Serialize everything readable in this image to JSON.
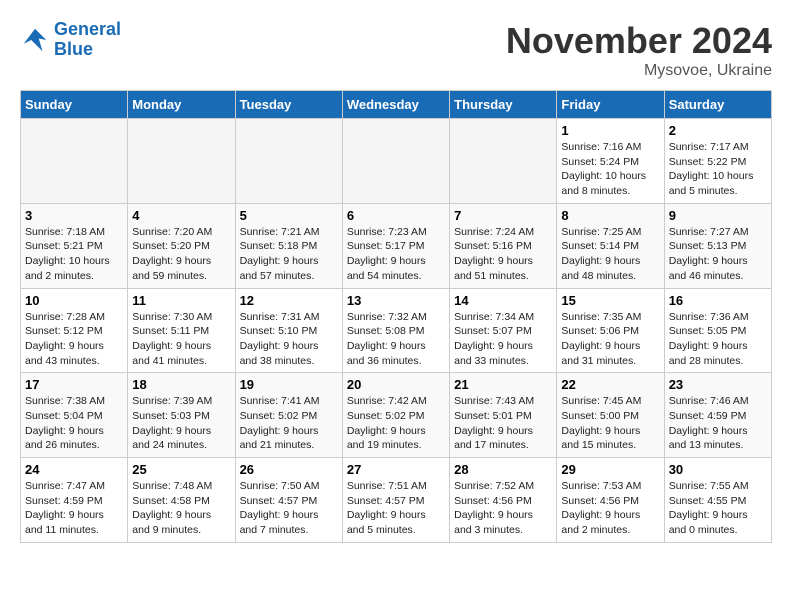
{
  "header": {
    "logo_line1": "General",
    "logo_line2": "Blue",
    "month_title": "November 2024",
    "location": "Mysovoe, Ukraine"
  },
  "days_of_week": [
    "Sunday",
    "Monday",
    "Tuesday",
    "Wednesday",
    "Thursday",
    "Friday",
    "Saturday"
  ],
  "weeks": [
    [
      {
        "day": "",
        "info": ""
      },
      {
        "day": "",
        "info": ""
      },
      {
        "day": "",
        "info": ""
      },
      {
        "day": "",
        "info": ""
      },
      {
        "day": "",
        "info": ""
      },
      {
        "day": "1",
        "info": "Sunrise: 7:16 AM\nSunset: 5:24 PM\nDaylight: 10 hours\nand 8 minutes."
      },
      {
        "day": "2",
        "info": "Sunrise: 7:17 AM\nSunset: 5:22 PM\nDaylight: 10 hours\nand 5 minutes."
      }
    ],
    [
      {
        "day": "3",
        "info": "Sunrise: 7:18 AM\nSunset: 5:21 PM\nDaylight: 10 hours\nand 2 minutes."
      },
      {
        "day": "4",
        "info": "Sunrise: 7:20 AM\nSunset: 5:20 PM\nDaylight: 9 hours\nand 59 minutes."
      },
      {
        "day": "5",
        "info": "Sunrise: 7:21 AM\nSunset: 5:18 PM\nDaylight: 9 hours\nand 57 minutes."
      },
      {
        "day": "6",
        "info": "Sunrise: 7:23 AM\nSunset: 5:17 PM\nDaylight: 9 hours\nand 54 minutes."
      },
      {
        "day": "7",
        "info": "Sunrise: 7:24 AM\nSunset: 5:16 PM\nDaylight: 9 hours\nand 51 minutes."
      },
      {
        "day": "8",
        "info": "Sunrise: 7:25 AM\nSunset: 5:14 PM\nDaylight: 9 hours\nand 48 minutes."
      },
      {
        "day": "9",
        "info": "Sunrise: 7:27 AM\nSunset: 5:13 PM\nDaylight: 9 hours\nand 46 minutes."
      }
    ],
    [
      {
        "day": "10",
        "info": "Sunrise: 7:28 AM\nSunset: 5:12 PM\nDaylight: 9 hours\nand 43 minutes."
      },
      {
        "day": "11",
        "info": "Sunrise: 7:30 AM\nSunset: 5:11 PM\nDaylight: 9 hours\nand 41 minutes."
      },
      {
        "day": "12",
        "info": "Sunrise: 7:31 AM\nSunset: 5:10 PM\nDaylight: 9 hours\nand 38 minutes."
      },
      {
        "day": "13",
        "info": "Sunrise: 7:32 AM\nSunset: 5:08 PM\nDaylight: 9 hours\nand 36 minutes."
      },
      {
        "day": "14",
        "info": "Sunrise: 7:34 AM\nSunset: 5:07 PM\nDaylight: 9 hours\nand 33 minutes."
      },
      {
        "day": "15",
        "info": "Sunrise: 7:35 AM\nSunset: 5:06 PM\nDaylight: 9 hours\nand 31 minutes."
      },
      {
        "day": "16",
        "info": "Sunrise: 7:36 AM\nSunset: 5:05 PM\nDaylight: 9 hours\nand 28 minutes."
      }
    ],
    [
      {
        "day": "17",
        "info": "Sunrise: 7:38 AM\nSunset: 5:04 PM\nDaylight: 9 hours\nand 26 minutes."
      },
      {
        "day": "18",
        "info": "Sunrise: 7:39 AM\nSunset: 5:03 PM\nDaylight: 9 hours\nand 24 minutes."
      },
      {
        "day": "19",
        "info": "Sunrise: 7:41 AM\nSunset: 5:02 PM\nDaylight: 9 hours\nand 21 minutes."
      },
      {
        "day": "20",
        "info": "Sunrise: 7:42 AM\nSunset: 5:02 PM\nDaylight: 9 hours\nand 19 minutes."
      },
      {
        "day": "21",
        "info": "Sunrise: 7:43 AM\nSunset: 5:01 PM\nDaylight: 9 hours\nand 17 minutes."
      },
      {
        "day": "22",
        "info": "Sunrise: 7:45 AM\nSunset: 5:00 PM\nDaylight: 9 hours\nand 15 minutes."
      },
      {
        "day": "23",
        "info": "Sunrise: 7:46 AM\nSunset: 4:59 PM\nDaylight: 9 hours\nand 13 minutes."
      }
    ],
    [
      {
        "day": "24",
        "info": "Sunrise: 7:47 AM\nSunset: 4:59 PM\nDaylight: 9 hours\nand 11 minutes."
      },
      {
        "day": "25",
        "info": "Sunrise: 7:48 AM\nSunset: 4:58 PM\nDaylight: 9 hours\nand 9 minutes."
      },
      {
        "day": "26",
        "info": "Sunrise: 7:50 AM\nSunset: 4:57 PM\nDaylight: 9 hours\nand 7 minutes."
      },
      {
        "day": "27",
        "info": "Sunrise: 7:51 AM\nSunset: 4:57 PM\nDaylight: 9 hours\nand 5 minutes."
      },
      {
        "day": "28",
        "info": "Sunrise: 7:52 AM\nSunset: 4:56 PM\nDaylight: 9 hours\nand 3 minutes."
      },
      {
        "day": "29",
        "info": "Sunrise: 7:53 AM\nSunset: 4:56 PM\nDaylight: 9 hours\nand 2 minutes."
      },
      {
        "day": "30",
        "info": "Sunrise: 7:55 AM\nSunset: 4:55 PM\nDaylight: 9 hours\nand 0 minutes."
      }
    ]
  ]
}
